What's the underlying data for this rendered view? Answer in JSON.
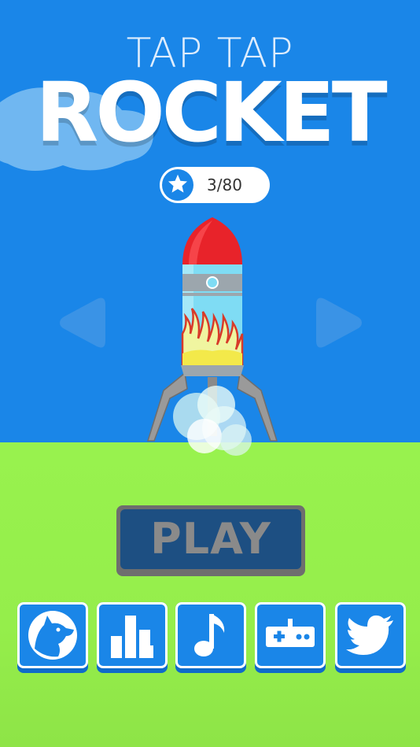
{
  "title": {
    "line1": "TAP TAP",
    "line2": "ROCKET"
  },
  "stars": {
    "count_text": "3/80"
  },
  "play_button": {
    "label": "PLAY"
  },
  "menu_icons": [
    "wolf-icon",
    "leaderboard-icon",
    "music-note-icon",
    "gamepad-icon",
    "twitter-icon"
  ],
  "colors": {
    "sky": "#1a86e8",
    "ground": "#95ee4b",
    "button_face": "#1d4f82",
    "button_border": "#6e6e6e",
    "rocket_nose": "#e8232a",
    "rocket_body": "#7fdcf4"
  }
}
